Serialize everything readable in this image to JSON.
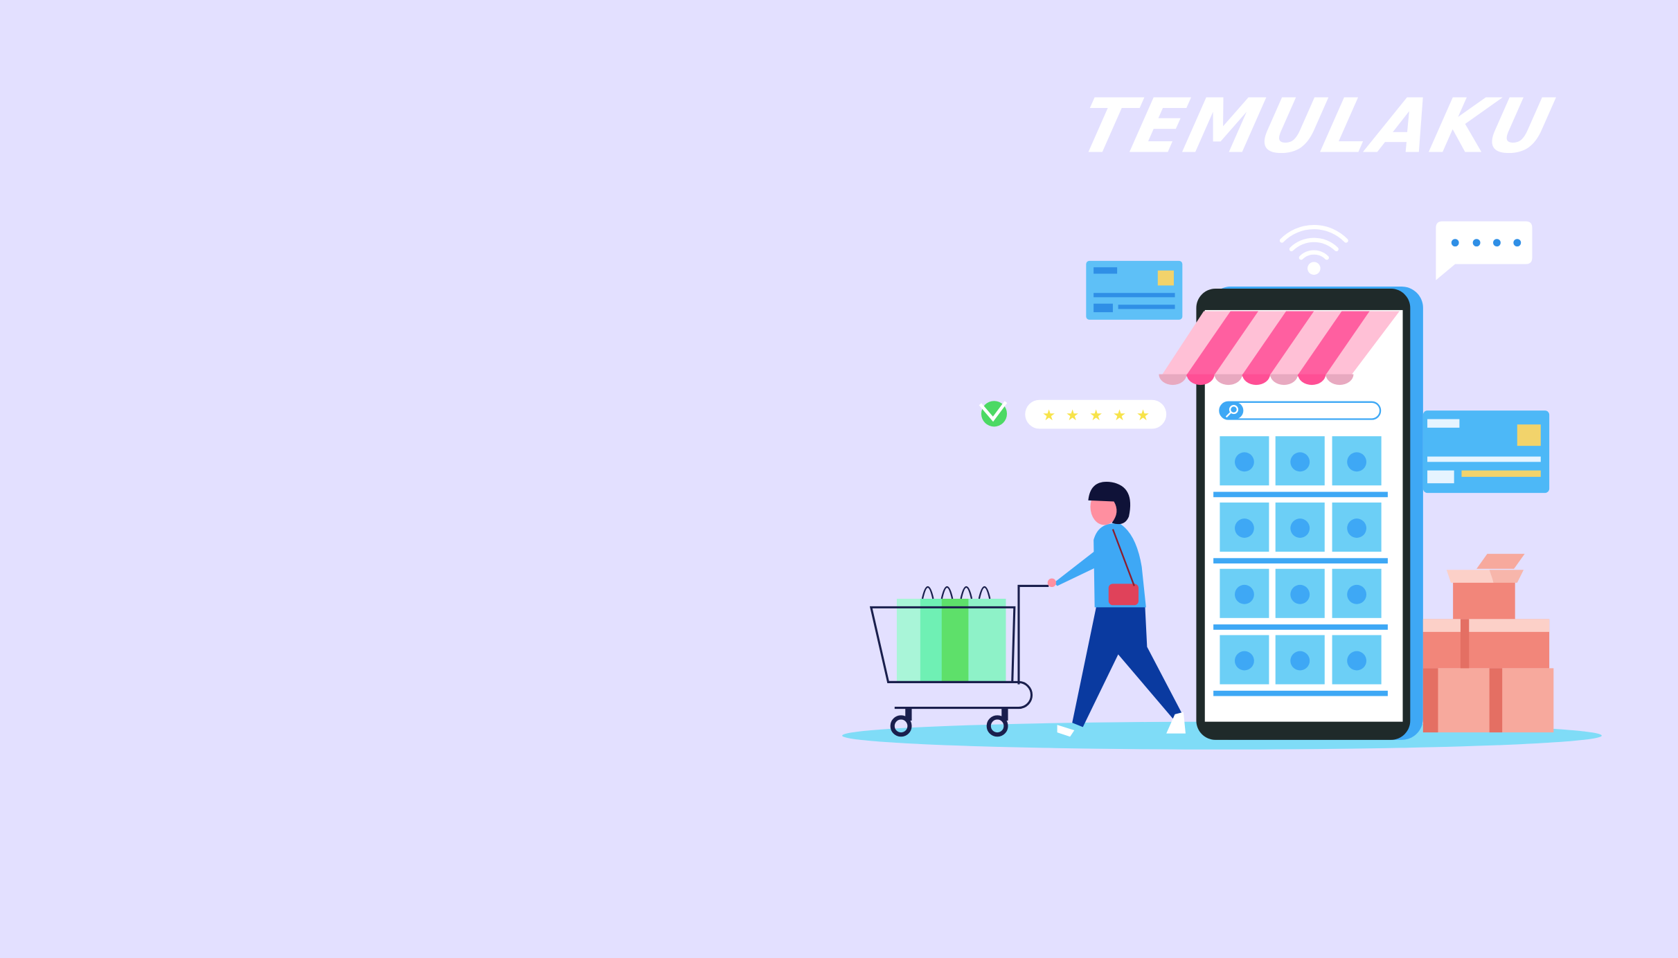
{
  "brand": {
    "logo_text": "TEMULAKU"
  },
  "rating": {
    "stars": 5
  },
  "colors": {
    "background": "#e3e0ff",
    "phone_body": "#3ea8f5",
    "phone_frame": "#1f2a2a",
    "awning_dark": "#ff5fa0",
    "awning_light": "#ffc0d6",
    "tile": "#6ccff6",
    "ground": "#7fdcf7",
    "box": "#f2867a",
    "check": "#4cd964",
    "star": "#f7e34a"
  }
}
